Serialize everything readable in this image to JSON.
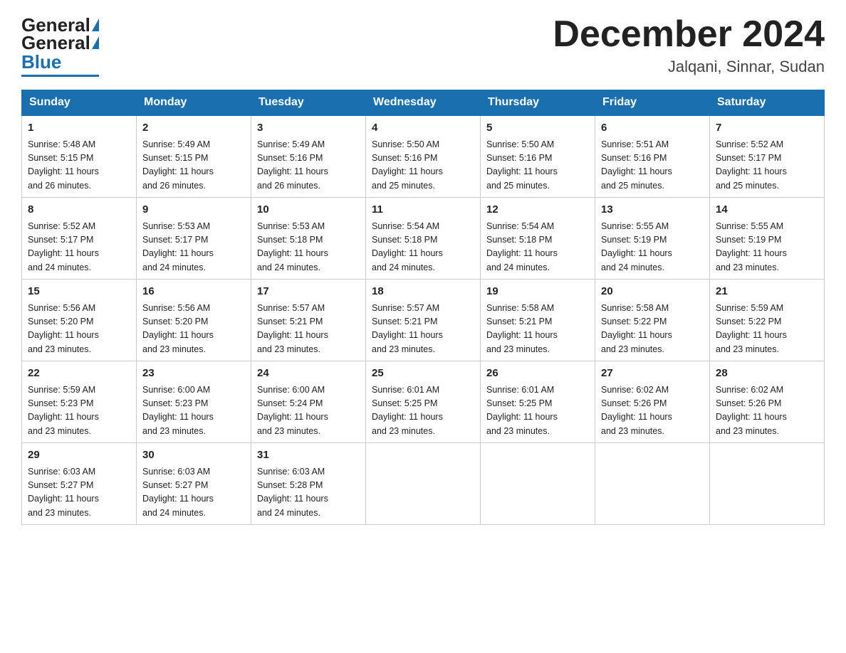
{
  "header": {
    "logo_general": "General",
    "logo_blue": "Blue",
    "title": "December 2024",
    "location": "Jalqani, Sinnar, Sudan"
  },
  "days_of_week": [
    "Sunday",
    "Monday",
    "Tuesday",
    "Wednesday",
    "Thursday",
    "Friday",
    "Saturday"
  ],
  "weeks": [
    [
      {
        "day": "1",
        "sunrise": "5:48 AM",
        "sunset": "5:15 PM",
        "daylight": "11 hours and 26 minutes."
      },
      {
        "day": "2",
        "sunrise": "5:49 AM",
        "sunset": "5:15 PM",
        "daylight": "11 hours and 26 minutes."
      },
      {
        "day": "3",
        "sunrise": "5:49 AM",
        "sunset": "5:16 PM",
        "daylight": "11 hours and 26 minutes."
      },
      {
        "day": "4",
        "sunrise": "5:50 AM",
        "sunset": "5:16 PM",
        "daylight": "11 hours and 25 minutes."
      },
      {
        "day": "5",
        "sunrise": "5:50 AM",
        "sunset": "5:16 PM",
        "daylight": "11 hours and 25 minutes."
      },
      {
        "day": "6",
        "sunrise": "5:51 AM",
        "sunset": "5:16 PM",
        "daylight": "11 hours and 25 minutes."
      },
      {
        "day": "7",
        "sunrise": "5:52 AM",
        "sunset": "5:17 PM",
        "daylight": "11 hours and 25 minutes."
      }
    ],
    [
      {
        "day": "8",
        "sunrise": "5:52 AM",
        "sunset": "5:17 PM",
        "daylight": "11 hours and 24 minutes."
      },
      {
        "day": "9",
        "sunrise": "5:53 AM",
        "sunset": "5:17 PM",
        "daylight": "11 hours and 24 minutes."
      },
      {
        "day": "10",
        "sunrise": "5:53 AM",
        "sunset": "5:18 PM",
        "daylight": "11 hours and 24 minutes."
      },
      {
        "day": "11",
        "sunrise": "5:54 AM",
        "sunset": "5:18 PM",
        "daylight": "11 hours and 24 minutes."
      },
      {
        "day": "12",
        "sunrise": "5:54 AM",
        "sunset": "5:18 PM",
        "daylight": "11 hours and 24 minutes."
      },
      {
        "day": "13",
        "sunrise": "5:55 AM",
        "sunset": "5:19 PM",
        "daylight": "11 hours and 24 minutes."
      },
      {
        "day": "14",
        "sunrise": "5:55 AM",
        "sunset": "5:19 PM",
        "daylight": "11 hours and 23 minutes."
      }
    ],
    [
      {
        "day": "15",
        "sunrise": "5:56 AM",
        "sunset": "5:20 PM",
        "daylight": "11 hours and 23 minutes."
      },
      {
        "day": "16",
        "sunrise": "5:56 AM",
        "sunset": "5:20 PM",
        "daylight": "11 hours and 23 minutes."
      },
      {
        "day": "17",
        "sunrise": "5:57 AM",
        "sunset": "5:21 PM",
        "daylight": "11 hours and 23 minutes."
      },
      {
        "day": "18",
        "sunrise": "5:57 AM",
        "sunset": "5:21 PM",
        "daylight": "11 hours and 23 minutes."
      },
      {
        "day": "19",
        "sunrise": "5:58 AM",
        "sunset": "5:21 PM",
        "daylight": "11 hours and 23 minutes."
      },
      {
        "day": "20",
        "sunrise": "5:58 AM",
        "sunset": "5:22 PM",
        "daylight": "11 hours and 23 minutes."
      },
      {
        "day": "21",
        "sunrise": "5:59 AM",
        "sunset": "5:22 PM",
        "daylight": "11 hours and 23 minutes."
      }
    ],
    [
      {
        "day": "22",
        "sunrise": "5:59 AM",
        "sunset": "5:23 PM",
        "daylight": "11 hours and 23 minutes."
      },
      {
        "day": "23",
        "sunrise": "6:00 AM",
        "sunset": "5:23 PM",
        "daylight": "11 hours and 23 minutes."
      },
      {
        "day": "24",
        "sunrise": "6:00 AM",
        "sunset": "5:24 PM",
        "daylight": "11 hours and 23 minutes."
      },
      {
        "day": "25",
        "sunrise": "6:01 AM",
        "sunset": "5:25 PM",
        "daylight": "11 hours and 23 minutes."
      },
      {
        "day": "26",
        "sunrise": "6:01 AM",
        "sunset": "5:25 PM",
        "daylight": "11 hours and 23 minutes."
      },
      {
        "day": "27",
        "sunrise": "6:02 AM",
        "sunset": "5:26 PM",
        "daylight": "11 hours and 23 minutes."
      },
      {
        "day": "28",
        "sunrise": "6:02 AM",
        "sunset": "5:26 PM",
        "daylight": "11 hours and 23 minutes."
      }
    ],
    [
      {
        "day": "29",
        "sunrise": "6:03 AM",
        "sunset": "5:27 PM",
        "daylight": "11 hours and 23 minutes."
      },
      {
        "day": "30",
        "sunrise": "6:03 AM",
        "sunset": "5:27 PM",
        "daylight": "11 hours and 24 minutes."
      },
      {
        "day": "31",
        "sunrise": "6:03 AM",
        "sunset": "5:28 PM",
        "daylight": "11 hours and 24 minutes."
      },
      null,
      null,
      null,
      null
    ]
  ],
  "labels": {
    "sunrise": "Sunrise:",
    "sunset": "Sunset:",
    "daylight": "Daylight:"
  }
}
